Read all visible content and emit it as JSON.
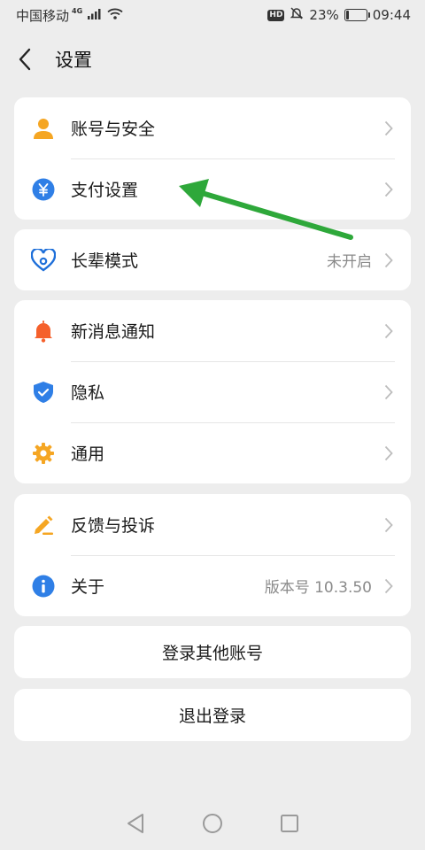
{
  "status_bar": {
    "carrier": "中国移动",
    "network": "4G",
    "hd": "HD",
    "battery_percent": "23%",
    "battery_level": 0.23,
    "time": "09:44"
  },
  "header": {
    "title": "设置"
  },
  "groups": {
    "account": {
      "items": [
        {
          "label": "账号与安全",
          "icon": "person-icon",
          "color": "#f5a623"
        },
        {
          "label": "支付设置",
          "icon": "yuan-icon",
          "color": "#2f7fe6"
        }
      ]
    },
    "elder": {
      "items": [
        {
          "label": "长辈模式",
          "value": "未开启",
          "icon": "heart-icon",
          "color": "#1e6fd9"
        }
      ]
    },
    "notify": {
      "items": [
        {
          "label": "新消息通知",
          "icon": "bell-icon",
          "color": "#f5602b"
        },
        {
          "label": "隐私",
          "icon": "shield-icon",
          "color": "#2f7fe6"
        },
        {
          "label": "通用",
          "icon": "gear-icon",
          "color": "#f5a623"
        }
      ]
    },
    "about": {
      "items": [
        {
          "label": "反馈与投诉",
          "icon": "pencil-icon",
          "color": "#f5a623"
        },
        {
          "label": "关于",
          "value": "版本号 10.3.50",
          "icon": "info-icon",
          "color": "#2f7fe6"
        }
      ]
    }
  },
  "actions": {
    "switch_account": "登录其他账号",
    "logout": "退出登录"
  },
  "annotation": {
    "arrow_color": "#2ea83a"
  }
}
